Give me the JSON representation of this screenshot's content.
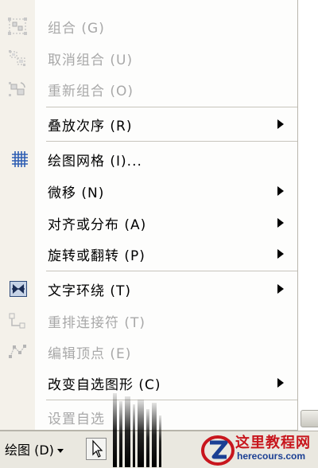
{
  "menu": {
    "items": [
      {
        "label": "组合 (G)",
        "icon": "group-icon",
        "enabled": false,
        "submenu": false
      },
      {
        "label": "取消组合 (U)",
        "icon": "ungroup-icon",
        "enabled": false,
        "submenu": false
      },
      {
        "label": "重新组合 (O)",
        "icon": "regroup-icon",
        "enabled": false,
        "submenu": false
      },
      {
        "label": "叠放次序 (R)",
        "icon": "",
        "enabled": true,
        "submenu": true
      },
      {
        "label": "绘图网格 (I)...",
        "icon": "grid-icon",
        "enabled": true,
        "submenu": false
      },
      {
        "label": "微移 (N)",
        "icon": "",
        "enabled": true,
        "submenu": true
      },
      {
        "label": "对齐或分布 (A)",
        "icon": "",
        "enabled": true,
        "submenu": true
      },
      {
        "label": "旋转或翻转 (P)",
        "icon": "",
        "enabled": true,
        "submenu": true
      },
      {
        "label": "文字环绕 (T)",
        "icon": "text-wrap-icon",
        "enabled": true,
        "submenu": true
      },
      {
        "label": "重排连接符 (T)",
        "icon": "reroute-connectors-icon",
        "enabled": false,
        "submenu": false
      },
      {
        "label": "编辑顶点 (E)",
        "icon": "edit-points-icon",
        "enabled": false,
        "submenu": false
      },
      {
        "label": "改变自选图形 (C)",
        "icon": "",
        "enabled": true,
        "submenu": true
      },
      {
        "label": "设置自选",
        "icon": "",
        "enabled": false,
        "submenu": false
      }
    ]
  },
  "toolbar": {
    "draw_label": "绘图 (D)",
    "pointer_icon": "pointer-arrow-icon"
  },
  "watermark": {
    "title": "这里教程网",
    "url": "herecours.com",
    "logo": "z-logo-icon"
  },
  "colors": {
    "menu_background": "#fdfdfc",
    "icon_gutter": "#f4f1ea",
    "disabled_text": "#a8a8a8",
    "watermark_red": "#c8161d",
    "watermark_blue": "#1b3f93"
  }
}
